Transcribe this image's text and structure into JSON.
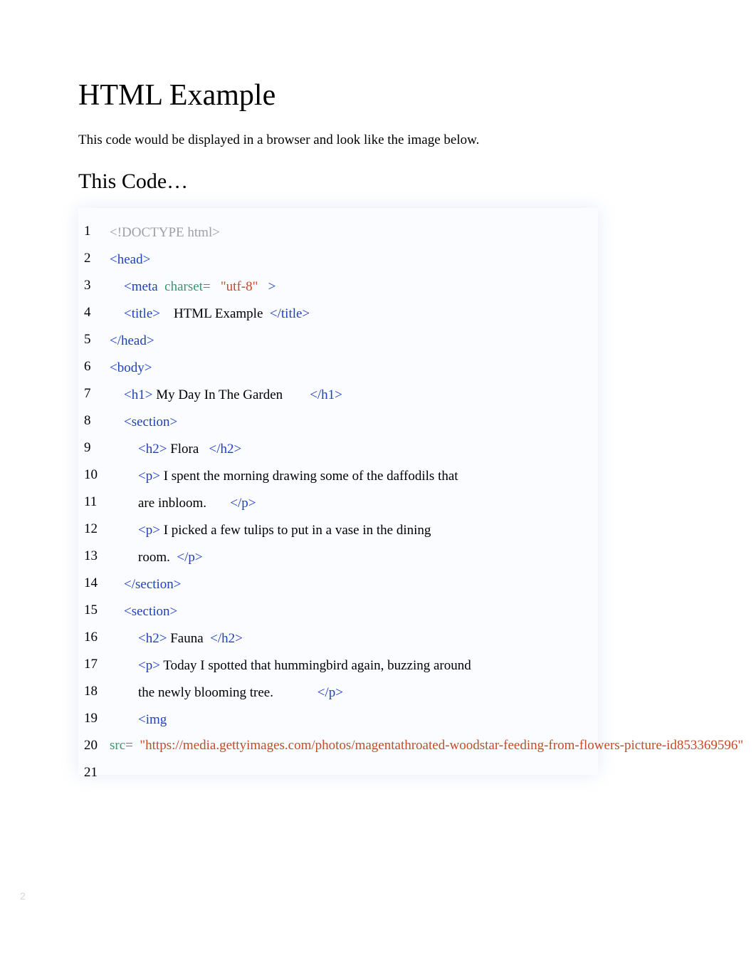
{
  "title": "HTML Example",
  "intro": "This code would be displayed in a browser and look like the image below.",
  "heading": "This Code…",
  "line_numbers": [
    "1",
    "2",
    "3",
    "4",
    "5",
    "6",
    "7",
    "8",
    "9",
    "10",
    "11",
    "12",
    "13",
    "14",
    "15",
    "16",
    "17",
    "18",
    "19",
    "20",
    "21"
  ],
  "code": {
    "l1_doctype": "<!DOCTYPE html>",
    "l2_head_open": "<head>",
    "l3_meta_tag": "<meta",
    "l3_attr": "charset=",
    "l3_val": "\"utf-8\"",
    "l3_close": ">",
    "l4_title_open": "<title>",
    "l4_text": " HTML Example ",
    "l4_title_close": "</title>",
    "l5_head_close": "</head>",
    "l6_body_open": "<body>",
    "l7_h1_open": "<h1>",
    "l7_text": " My Day In The Garden",
    "l7_h1_close": "</h1>",
    "l8_section_open": "<section>",
    "l9_h2_open": "<h2>",
    "l9_text": " Flora ",
    "l9_h2_close": "</h2>",
    "l10_p_open": "<p>",
    "l10_text": " I spent the morning drawing some of the daffodils that",
    "l11_text": "are inbloom.",
    "l11_p_close": "</p>",
    "l12_p_open": "<p>",
    "l12_text": " I picked a few tulips to put in a vase in the dining",
    "l13_text": "room. ",
    "l13_p_close": "</p>",
    "l14_section_close": "</section>",
    "l15_section_open": "<section>",
    "l16_h2_open": "<h2>",
    "l16_text": " Fauna ",
    "l16_h2_close": "</h2>",
    "l17_p_open": "<p>",
    "l17_text": " Today I spotted that hummingbird again, buzzing around",
    "l18_text": "the newly blooming tree.",
    "l18_p_close": "</p>",
    "l19_img": "<img",
    "l20_attr": "src=",
    "l20_val": "\"https://media.gettyimages.com/photos/magentathroated-woodstar-feeding-from-flowers-picture-id853369596\""
  },
  "page_number": "2"
}
